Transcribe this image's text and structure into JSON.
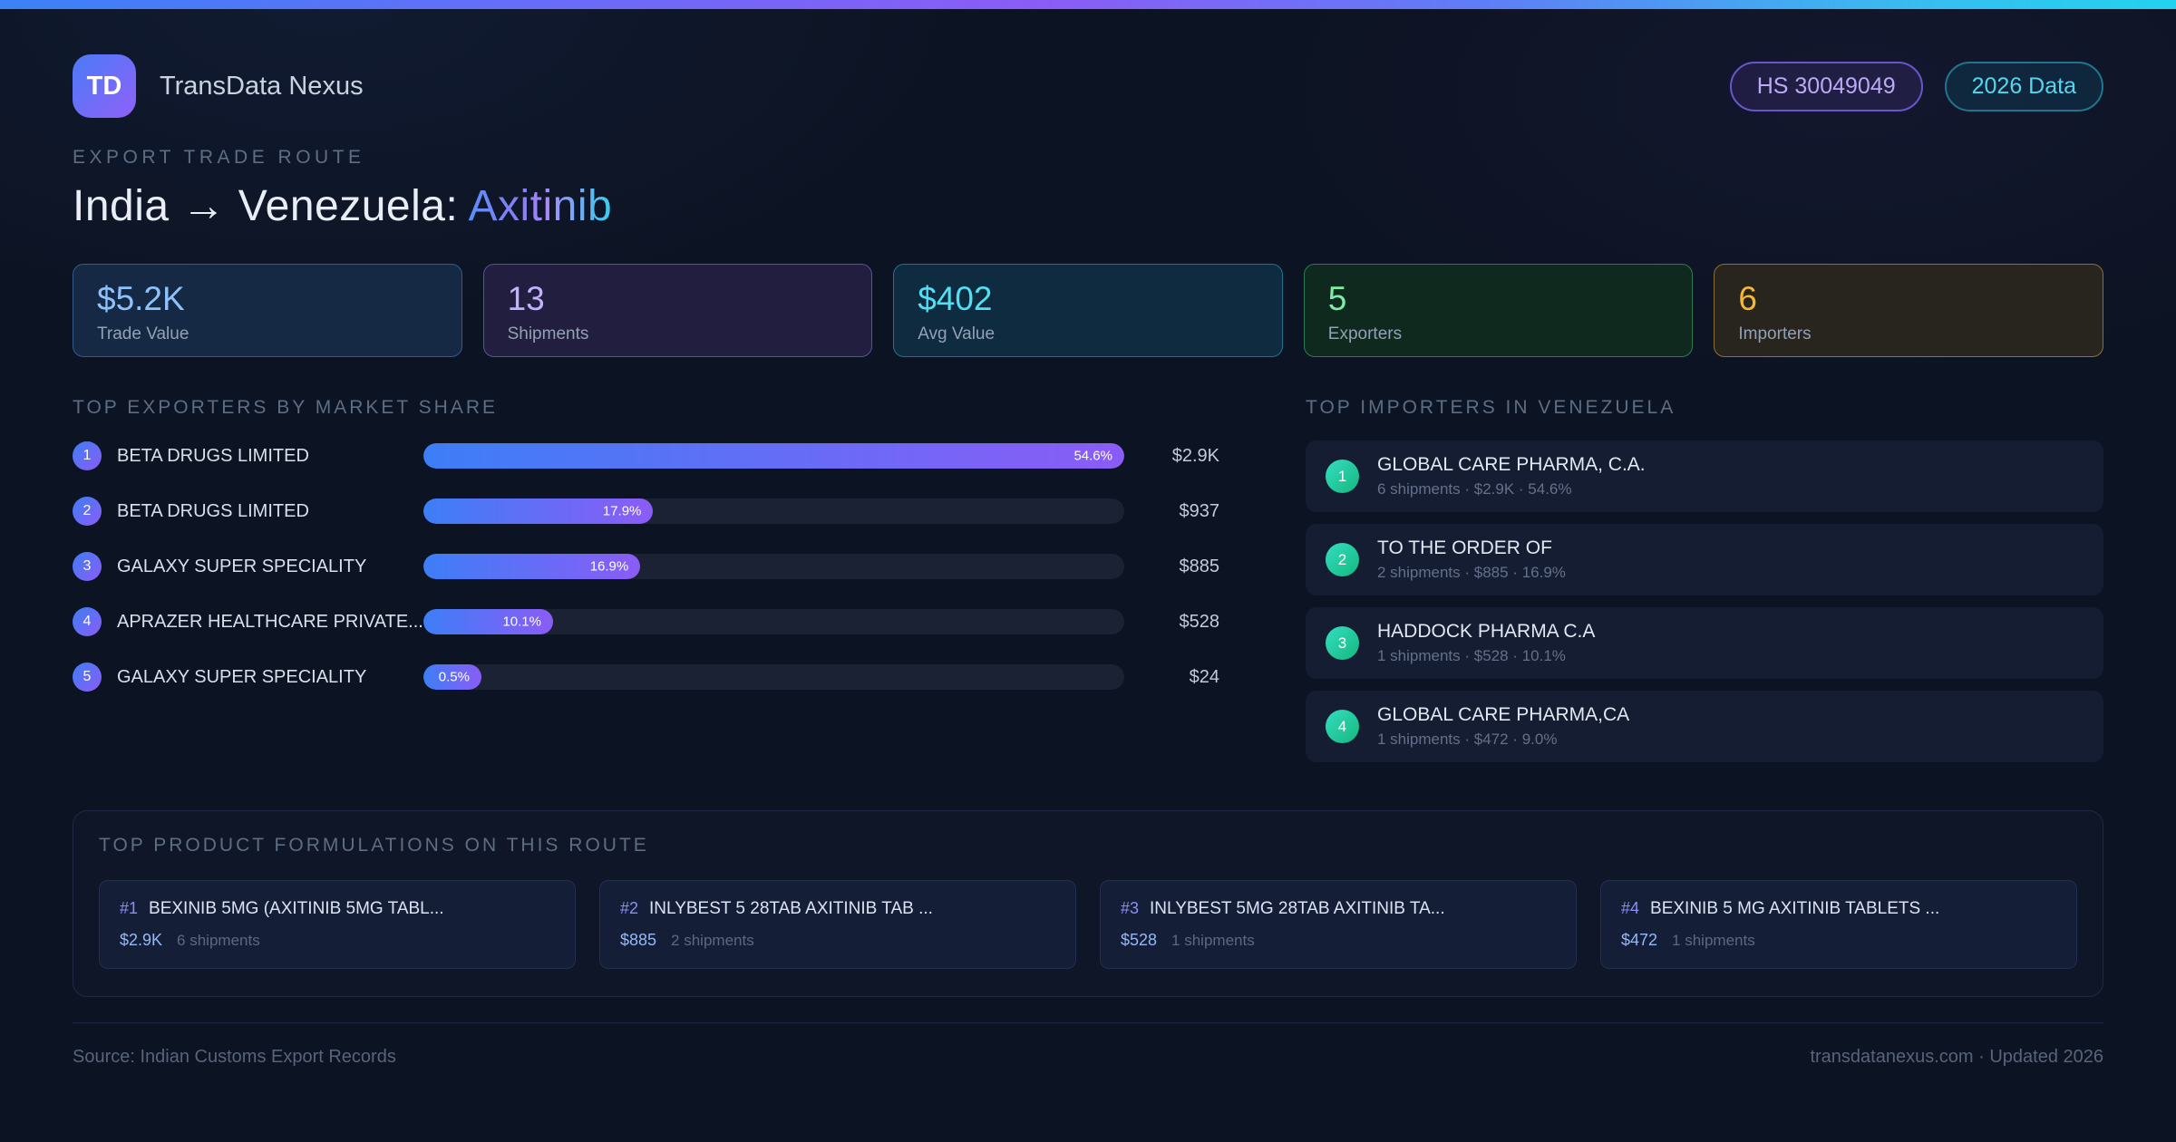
{
  "header": {
    "logo_text": "TD",
    "brand": "TransData Nexus",
    "hs_badge": "HS 30049049",
    "year_badge": "2026 Data"
  },
  "hero": {
    "eyebrow": "EXPORT TRADE ROUTE",
    "title_main": "India → Venezuela: ",
    "title_accent": "Axitinib"
  },
  "stats": [
    {
      "value": "$5.2K",
      "label": "Trade Value",
      "style": "blue"
    },
    {
      "value": "13",
      "label": "Shipments",
      "style": "purple"
    },
    {
      "value": "$402",
      "label": "Avg Value",
      "style": "cyan"
    },
    {
      "value": "5",
      "label": "Exporters",
      "style": "green"
    },
    {
      "value": "6",
      "label": "Importers",
      "style": "amber"
    }
  ],
  "exporters": {
    "heading": "TOP EXPORTERS BY MARKET SHARE",
    "max_share_pct": 54.6,
    "rows": [
      {
        "rank": "1",
        "name": "BETA DRUGS LIMITED",
        "share_pct": 54.6,
        "share_label": "54.6%",
        "value": "$2.9K"
      },
      {
        "rank": "2",
        "name": "BETA DRUGS LIMITED",
        "share_pct": 17.9,
        "share_label": "17.9%",
        "value": "$937"
      },
      {
        "rank": "3",
        "name": "GALAXY SUPER SPECIALITY",
        "share_pct": 16.9,
        "share_label": "16.9%",
        "value": "$885"
      },
      {
        "rank": "4",
        "name": "APRAZER HEALTHCARE PRIVATE...",
        "share_pct": 10.1,
        "share_label": "10.1%",
        "value": "$528"
      },
      {
        "rank": "5",
        "name": "GALAXY SUPER SPECIALITY",
        "share_pct": 0.5,
        "share_label": "0.5%",
        "value": "$24"
      }
    ]
  },
  "importers": {
    "heading": "TOP IMPORTERS IN VENEZUELA",
    "items": [
      {
        "rank": "1",
        "name": "GLOBAL CARE PHARMA, C.A.",
        "detail": "6 shipments · $2.9K · 54.6%"
      },
      {
        "rank": "2",
        "name": "TO THE ORDER OF",
        "detail": "2 shipments · $885 · 16.9%"
      },
      {
        "rank": "3",
        "name": "HADDOCK PHARMA C.A",
        "detail": "1 shipments · $528 · 10.1%"
      },
      {
        "rank": "4",
        "name": "GLOBAL CARE PHARMA,CA",
        "detail": "1 shipments · $472 · 9.0%"
      }
    ]
  },
  "products": {
    "heading": "TOP PRODUCT FORMULATIONS ON THIS ROUTE",
    "cards": [
      {
        "rank": "#1",
        "name": "BEXINIB 5MG (AXITINIB 5MG TABL...",
        "value": "$2.9K",
        "shipments": "6 shipments"
      },
      {
        "rank": "#2",
        "name": "INLYBEST 5 28TAB AXITINIB TAB ...",
        "value": "$885",
        "shipments": "2 shipments"
      },
      {
        "rank": "#3",
        "name": "INLYBEST 5MG 28TAB AXITINIB TA...",
        "value": "$528",
        "shipments": "1 shipments"
      },
      {
        "rank": "#4",
        "name": "BEXINIB 5 MG AXITINIB TABLETS ...",
        "value": "$472",
        "shipments": "1 shipments"
      }
    ]
  },
  "footer": {
    "source": "Source: Indian Customs Export Records",
    "site": "transdatanexus.com · Updated 2026"
  },
  "colors": {
    "accent_blue": "#3b82f6",
    "accent_purple": "#8b5cf6",
    "accent_cyan": "#22d3ee",
    "accent_green": "#7deea6",
    "accent_amber": "#f6b833"
  }
}
